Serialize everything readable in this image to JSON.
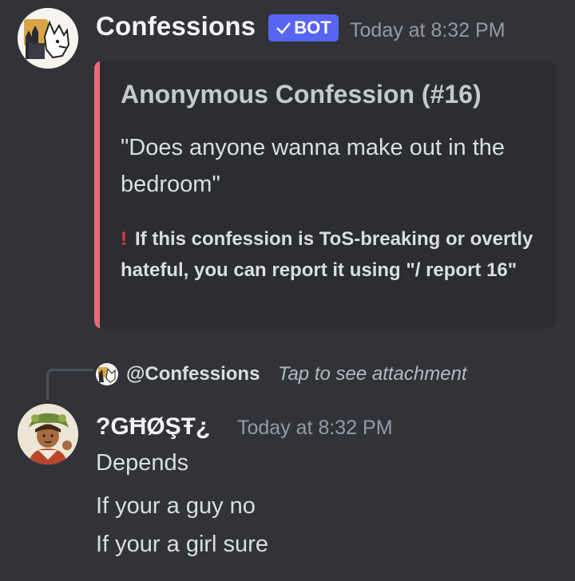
{
  "post1": {
    "author": "Confessions",
    "bot_tag": "BOT",
    "timestamp": "Today at 8:32 PM",
    "embed": {
      "title": "Anonymous Confession (#16)",
      "description": "\"Does anyone wanna make out in the bedroom\"",
      "note_icon": "!",
      "note": "If this confession is ToS-breaking or overtly hateful, you can report it using \"/ report 16\"",
      "accent_color": "#e86a74"
    }
  },
  "reply": {
    "mention": "@Confessions",
    "attachment_text": "Tap to see attachment"
  },
  "post2": {
    "author": "?GĦØŞŦ¿",
    "timestamp": "Today at 8:32 PM",
    "messages": [
      "Depends",
      "If your a guy no",
      "If your a girl sure"
    ]
  },
  "colors": {
    "background": "#323339",
    "embed_bg": "#2b2d31",
    "bot_tag": "#5865f2"
  }
}
